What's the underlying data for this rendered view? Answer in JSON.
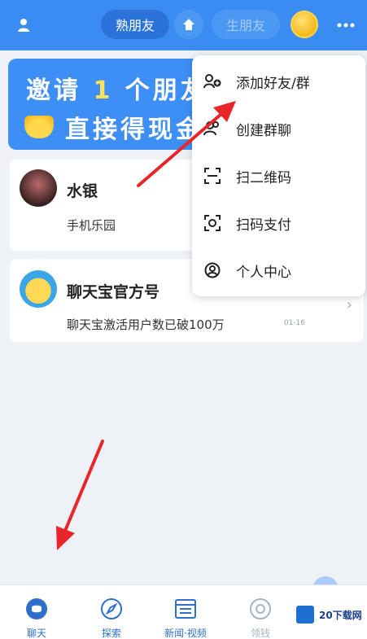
{
  "header": {
    "tab_active": "熟朋友",
    "tab_faded": "生朋友"
  },
  "banner": {
    "line1_prefix": "邀请",
    "line1_number": "1",
    "line1_suffix": "个朋友",
    "line2": "直接得现金"
  },
  "chats": [
    {
      "name": "水银",
      "subtitle": "手机乐园"
    },
    {
      "name": "聊天宝官方号",
      "subtitle": "聊天宝激活用户数已破100万",
      "date": "01-16"
    }
  ],
  "dropdown": {
    "items": [
      {
        "label": "添加好友/群",
        "icon": "add-friend-icon"
      },
      {
        "label": "创建群聊",
        "icon": "create-group-icon"
      },
      {
        "label": "扫二维码",
        "icon": "scan-icon"
      },
      {
        "label": "扫码支付",
        "icon": "scan-pay-icon"
      },
      {
        "label": "个人中心",
        "icon": "profile-icon"
      }
    ]
  },
  "bottom_nav": [
    {
      "label": "聊天",
      "icon": "chat-icon"
    },
    {
      "label": "探索",
      "icon": "compass-icon"
    },
    {
      "label": "新闻·视频",
      "icon": "news-icon"
    },
    {
      "label": "领钱",
      "icon": "coin-icon"
    }
  ],
  "watermark": {
    "text": "20下载网"
  },
  "colors": {
    "accent": "#3b8cf2",
    "nav_active": "#2f6fc9",
    "arrow": "#e8262a"
  }
}
